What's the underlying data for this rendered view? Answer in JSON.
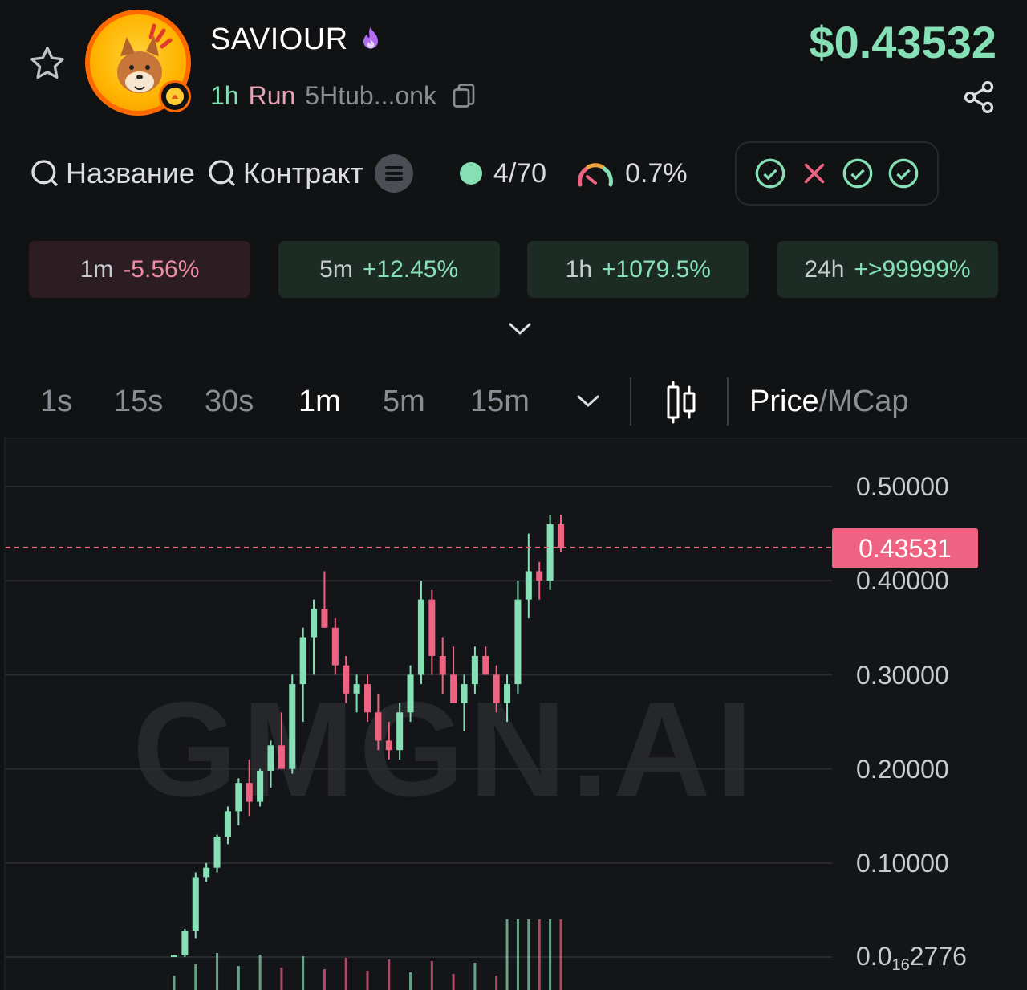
{
  "token": {
    "name": "SAVIOUR",
    "age": "1h",
    "run_label": "Run",
    "address_short": "5Htub...onk",
    "price": "$0.43532"
  },
  "search": {
    "name_label": "Название",
    "contract_label": "Контракт"
  },
  "stats": {
    "holders": "4/70",
    "gauge_value": "0.7%",
    "checks": [
      "pass",
      "fail",
      "pass",
      "pass"
    ]
  },
  "changes": [
    {
      "interval": "1m",
      "value": "-5.56%",
      "direction": "down"
    },
    {
      "interval": "5m",
      "value": "+12.45%",
      "direction": "up"
    },
    {
      "interval": "1h",
      "value": "+1079.5%",
      "direction": "up"
    },
    {
      "interval": "24h",
      "value": "+>99999%",
      "direction": "up"
    }
  ],
  "timeframes": {
    "items": [
      "1s",
      "15s",
      "30s",
      "1m",
      "5m",
      "15m"
    ],
    "active": "1m"
  },
  "toggle": {
    "price_label": "Price",
    "separator": "/",
    "mcap_label": "MCap"
  },
  "colors": {
    "up": "#86e0b5",
    "down": "#ed6381",
    "background": "#111214"
  },
  "chart_data": {
    "type": "candlestick",
    "watermark": "GMGN.AI",
    "y_ticks": [
      "0.50000",
      "0.40000",
      "0.30000",
      "0.20000",
      "0.10000"
    ],
    "y_min_label_prefix": "0.0",
    "y_min_label_sub": "16",
    "y_min_label_suffix": "2776",
    "current_price_label": "0.43531",
    "current_price": 0.43531,
    "ylim": [
      0,
      0.5
    ],
    "grid": true,
    "candles": [
      [
        0.0,
        0.002,
        0.0,
        0.002
      ],
      [
        0.002,
        0.03,
        0.0,
        0.028
      ],
      [
        0.028,
        0.09,
        0.02,
        0.085
      ],
      [
        0.085,
        0.1,
        0.08,
        0.095
      ],
      [
        0.095,
        0.13,
        0.09,
        0.128
      ],
      [
        0.128,
        0.16,
        0.12,
        0.155
      ],
      [
        0.155,
        0.19,
        0.14,
        0.185
      ],
      [
        0.185,
        0.21,
        0.15,
        0.165
      ],
      [
        0.165,
        0.2,
        0.16,
        0.198
      ],
      [
        0.198,
        0.23,
        0.18,
        0.225
      ],
      [
        0.225,
        0.26,
        0.2,
        0.2
      ],
      [
        0.2,
        0.3,
        0.195,
        0.29
      ],
      [
        0.29,
        0.35,
        0.25,
        0.34
      ],
      [
        0.34,
        0.38,
        0.3,
        0.37
      ],
      [
        0.37,
        0.41,
        0.35,
        0.35
      ],
      [
        0.35,
        0.36,
        0.3,
        0.31
      ],
      [
        0.31,
        0.32,
        0.27,
        0.28
      ],
      [
        0.28,
        0.3,
        0.26,
        0.29
      ],
      [
        0.29,
        0.3,
        0.25,
        0.26
      ],
      [
        0.26,
        0.28,
        0.22,
        0.23
      ],
      [
        0.23,
        0.25,
        0.21,
        0.22
      ],
      [
        0.22,
        0.27,
        0.21,
        0.26
      ],
      [
        0.26,
        0.31,
        0.25,
        0.3
      ],
      [
        0.3,
        0.4,
        0.29,
        0.38
      ],
      [
        0.38,
        0.39,
        0.3,
        0.32
      ],
      [
        0.32,
        0.34,
        0.28,
        0.3
      ],
      [
        0.3,
        0.33,
        0.27,
        0.27
      ],
      [
        0.27,
        0.3,
        0.24,
        0.29
      ],
      [
        0.29,
        0.33,
        0.28,
        0.32
      ],
      [
        0.32,
        0.33,
        0.3,
        0.3
      ],
      [
        0.3,
        0.31,
        0.26,
        0.27
      ],
      [
        0.27,
        0.3,
        0.25,
        0.29
      ],
      [
        0.29,
        0.4,
        0.28,
        0.38
      ],
      [
        0.38,
        0.45,
        0.36,
        0.41
      ],
      [
        0.41,
        0.42,
        0.38,
        0.4
      ],
      [
        0.4,
        0.47,
        0.39,
        0.46
      ],
      [
        0.46,
        0.47,
        0.43,
        0.435
      ]
    ]
  }
}
